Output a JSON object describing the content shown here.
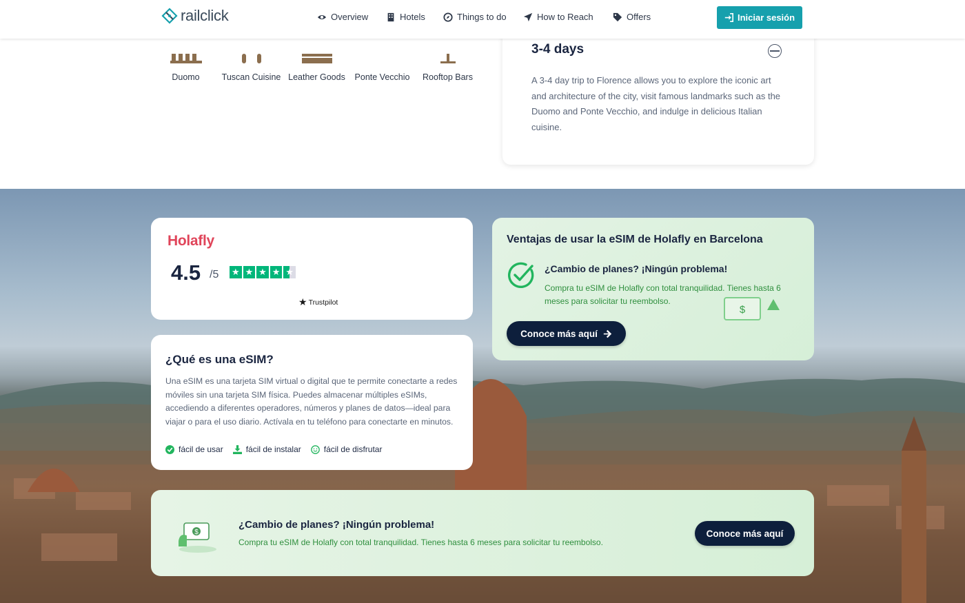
{
  "header": {
    "brand": "railclick",
    "nav": [
      {
        "label": "Overview",
        "icon": "eye-icon"
      },
      {
        "label": "Hotels",
        "icon": "building-icon"
      },
      {
        "label": "Things to do",
        "icon": "compass-icon"
      },
      {
        "label": "How to Reach",
        "icon": "location-arrow-icon"
      },
      {
        "label": "Offers",
        "icon": "tag-icon"
      }
    ],
    "login_label": "Iniciar sesión",
    "accent_color": "#16a0ad"
  },
  "attractions": [
    {
      "label": "Duomo"
    },
    {
      "label": "Tuscan Cuisine"
    },
    {
      "label": "Leather Goods"
    },
    {
      "label": "Ponte Vecchio"
    },
    {
      "label": "Rooftop Bars"
    }
  ],
  "trip": {
    "title": "3-4 days",
    "description": "A 3-4 day trip to Florence allows you to explore the iconic art and architecture of the city, visit famous landmarks such as the Duomo and Ponte Vecchio, and indulge in delicious Italian cuisine."
  },
  "holafly": {
    "brand": "Holafly",
    "rating": "4.5",
    "rating_of": "/5",
    "stars_filled": 4.5,
    "trustpilot": "Trustpilot"
  },
  "esim": {
    "title": "¿Qué es una eSIM?",
    "description": "Una eSIM es una tarjeta SIM virtual o digital que te permite conectarte a redes móviles sin una tarjeta SIM física. Puedes almacenar múltiples eSIMs, accediendo a diferentes operadores, números y planes de datos—ideal para viajar o para el uso diario. Actívala en tu teléfono para conectarte en minutos.",
    "features": [
      {
        "label": "fácil de usar",
        "icon": "check-circle-icon"
      },
      {
        "label": "fácil de instalar",
        "icon": "download-icon"
      },
      {
        "label": "fácil de disfrutar",
        "icon": "smile-icon"
      }
    ]
  },
  "benefits": {
    "title": "Ventajas de usar la eSIM de Holafly en Barcelona",
    "heading": "¿Cambio de planes? ¡Ningún problema!",
    "text": "Compra tu eSIM de Holafly con total tranquilidad. Tienes hasta 6 meses para solicitar tu reembolso.",
    "money_symbol": "$",
    "button_label": "Conoce más aquí"
  },
  "bottom_banner": {
    "heading": "¿Cambio de planes? ¡Ningún problema!",
    "text": "Compra tu eSIM de Holafly con total tranquilidad. Tienes hasta 6 meses para solicitar tu reembolso.",
    "button_label": "Conoce más aquí",
    "money_symbol": "$"
  }
}
